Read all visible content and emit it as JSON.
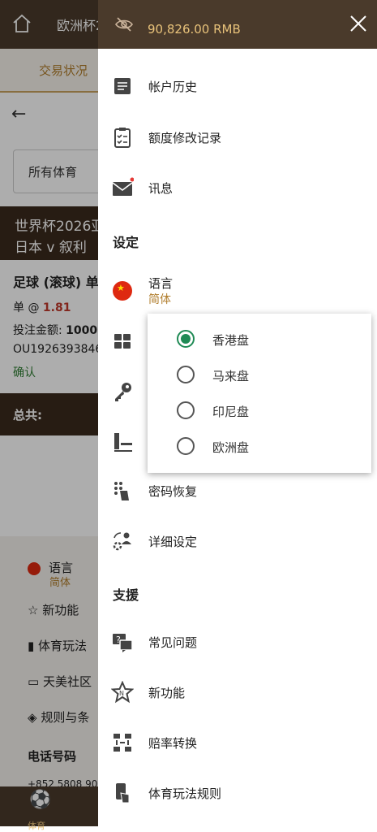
{
  "colors": {
    "brand_dark": "#4a3a2b",
    "accent_gold": "#e8c27a",
    "selected_green": "#1f8a55"
  },
  "background": {
    "title": "欧洲杯2",
    "tab_active": "交易状况",
    "sport_filter": "所有体育",
    "match_line1": "世界杯2026亚",
    "match_line2": "日本 v 叙利",
    "bet_title": "足球 (滚球) 单",
    "bet_type_prefix": "单 @",
    "bet_odds": "1.81",
    "stake_label": "投注金额:",
    "stake_value": "1000",
    "ticket_id": "OU1926393846",
    "status": "确认",
    "total_label": "总共:",
    "footer": {
      "language": "语言",
      "language_sub": "简体",
      "new_features": "新功能",
      "sports_rules": "体育玩法",
      "community": "天美社区",
      "rules_terms": "规则与条",
      "phone_label": "电话号码",
      "phone_value": "+852 5808 906"
    },
    "bottom_nav_label": "体育"
  },
  "drawer": {
    "balance": "90,826.00 RMB",
    "items": {
      "account_history": "帐户历史",
      "limit_history": "额度修改记录",
      "messages": "讯息",
      "settings_section": "设定",
      "language": "语言",
      "language_value": "简体",
      "password_recovery": "密码恢复",
      "detailed_settings": "详细设定",
      "support_section": "支援",
      "faq": "常见问题",
      "new_features": "新功能",
      "odds_conversion": "赔率转换",
      "sports_rules": "体育玩法规则"
    }
  },
  "odds_popup": {
    "options": [
      "香港盘",
      "马来盘",
      "印尼盘",
      "欧洲盘"
    ],
    "selected": "香港盘"
  }
}
